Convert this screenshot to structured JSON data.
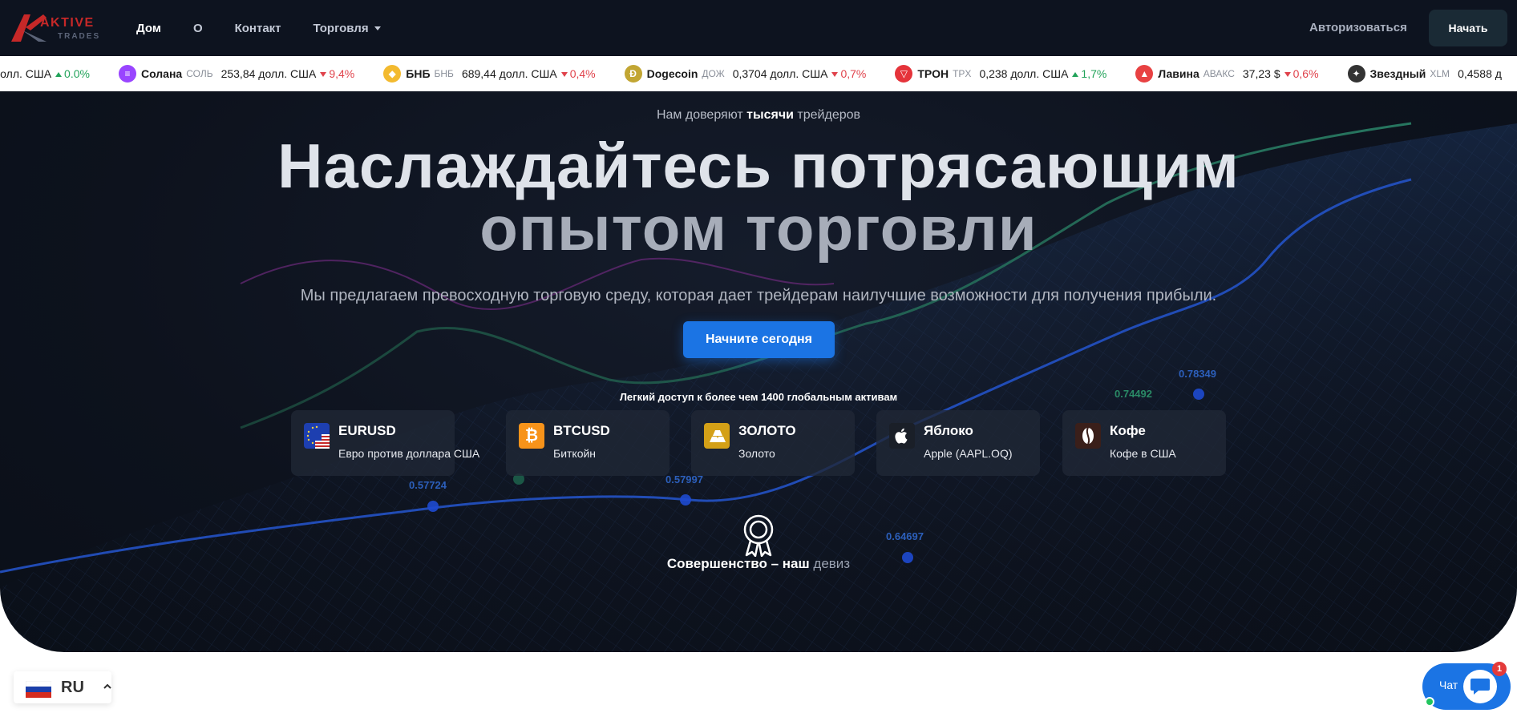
{
  "nav": {
    "logo_top": "AKTIVE",
    "logo_bottom": "TRADES",
    "links": [
      "Дом",
      "О",
      "Контакт",
      "Торговля"
    ],
    "login": "Авторизоваться",
    "start": "Начать"
  },
  "ticker": [
    {
      "name": "",
      "symbol": "",
      "price": "долл. США",
      "change": "0.0%",
      "dir": "up",
      "icon": "none-icon",
      "color": "#ffffff"
    },
    {
      "name": "Солана",
      "symbol": "СОЛЬ",
      "price": "253,84 долл. США",
      "change": "9,4%",
      "dir": "down",
      "icon": "solana-icon",
      "color": "#9945ff"
    },
    {
      "name": "БНБ",
      "symbol": "БНБ",
      "price": "689,44 долл. США",
      "change": "0,4%",
      "dir": "down",
      "icon": "bnb-icon",
      "color": "#f3ba2f"
    },
    {
      "name": "Dogecoin",
      "symbol": "ДОЖ",
      "price": "0,3704 долл. США",
      "change": "0,7%",
      "dir": "down",
      "icon": "dogecoin-icon",
      "color": "#c2a633"
    },
    {
      "name": "ТРОН",
      "symbol": "TPX",
      "price": "0,238 долл. США",
      "change": "1,7%",
      "dir": "up",
      "icon": "tron-icon",
      "color": "#e5333a"
    },
    {
      "name": "Лавина",
      "symbol": "АВАКС",
      "price": "37,23 $",
      "change": "0,6%",
      "dir": "down",
      "icon": "avalanche-icon",
      "color": "#e84142"
    },
    {
      "name": "Звездный",
      "symbol": "XLM",
      "price": "0,4588 д",
      "change": "",
      "dir": "",
      "icon": "stellar-icon",
      "color": "#333333"
    }
  ],
  "hero": {
    "trusted_prefix": "Нам доверяют ",
    "trusted_bold": "тысячи",
    "trusted_suffix": " трейдеров",
    "headline_1": "Наслаждайтесь потрясающим",
    "headline_2": "опытом торговли",
    "subtext": "Мы предлагаем превосходную торговую среду, которая дает трейдерам наилучшие возможности для получения прибыли.",
    "cta": "Начните сегодня",
    "access": "Легкий доступ к более чем 1400 глобальным активам",
    "motto_main": "Совершенство – наш ",
    "motto_grey": "девиз"
  },
  "assets": [
    {
      "title": "EURUSD",
      "subtitle": "Евро против доллара США",
      "icon": "eu-us-flag-icon"
    },
    {
      "title": "BTCUSD",
      "subtitle": "Биткойн",
      "icon": "bitcoin-icon"
    },
    {
      "title": "ЗОЛОТО",
      "subtitle": "Золото",
      "icon": "gold-bars-icon"
    },
    {
      "title": "Яблоко",
      "subtitle": "Apple (AAPL.OQ)",
      "icon": "apple-icon"
    },
    {
      "title": "Кофе",
      "subtitle": "Кофе в США",
      "icon": "coffee-bean-icon"
    }
  ],
  "chart_labels": [
    "0.78349",
    "0.74492",
    "0.64697",
    "0.57724",
    "0.57997"
  ],
  "language": {
    "code": "RU"
  },
  "chat": {
    "label": "Чат",
    "badge": "1"
  },
  "colors": {
    "accent": "#1b74e4",
    "hero_bg": "#0d121d",
    "up": "#22a35a",
    "down": "#e0424b",
    "logo_red": "#c62828"
  }
}
